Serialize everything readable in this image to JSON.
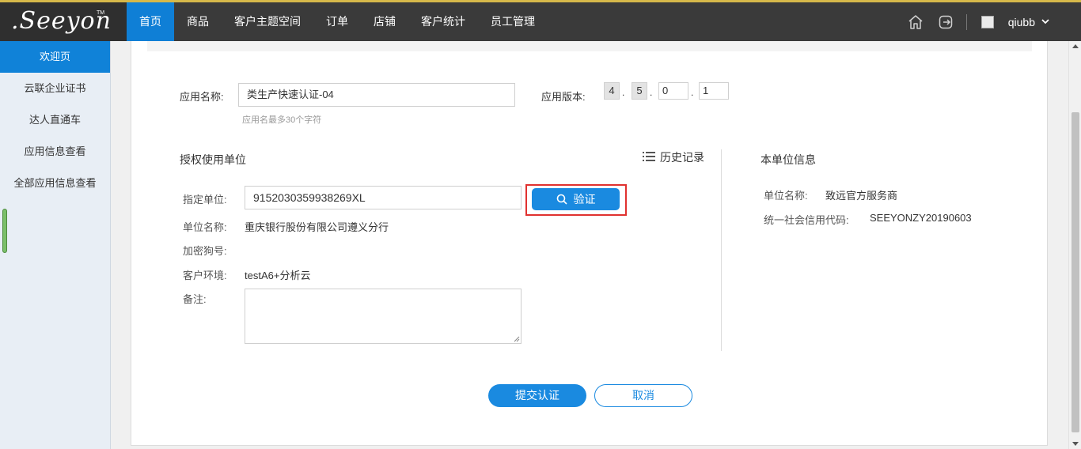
{
  "header": {
    "logo_text": ".Seeyon",
    "logo_tm": "TM",
    "nav": [
      "首页",
      "商品",
      "客户主题空间",
      "订单",
      "店铺",
      "客户统计",
      "员工管理"
    ],
    "active_nav": "首页",
    "username": "qiubb",
    "icons": [
      "home-icon",
      "logout-icon",
      "avatar-image",
      "chevron-down-icon"
    ]
  },
  "sidebar": {
    "items": [
      "欢迎页",
      "云联企业证书",
      "达人直通车",
      "应用信息查看",
      "全部应用信息查看"
    ],
    "active": "欢迎页"
  },
  "form": {
    "app_name_label": "应用名称:",
    "app_name_value": "类生产快速认证-04",
    "app_name_hint": "应用名最多30个字符",
    "version_label": "应用版本:",
    "version": [
      "4",
      "5",
      "0",
      "1"
    ],
    "authorized_title": "授权使用单位",
    "history_label": "历史记录",
    "designated_label": "指定单位:",
    "designated_value": "9152030359938269XL",
    "verify_label": "验证",
    "unit_name_label": "单位名称:",
    "unit_name_value": "重庆银行股份有限公司遵义分行",
    "dongle_label": "加密狗号:",
    "dongle_value": "",
    "env_label": "客户环境:",
    "env_value": "testA6+分析云",
    "remark_label": "备注:",
    "remark_value": "",
    "submit_label": "提交认证",
    "cancel_label": "取消"
  },
  "own_unit": {
    "title": "本单位信息",
    "name_label": "单位名称:",
    "name_value": "致远官方服务商",
    "credit_label": "统一社会信用代码:",
    "credit_value": "SEEYONZY20190603"
  },
  "colors": {
    "topbar": "#3a3a3a",
    "accent": "#1a8ae0",
    "highlight_outline": "#e0312f",
    "sidebar_bg": "#e8eef5"
  }
}
